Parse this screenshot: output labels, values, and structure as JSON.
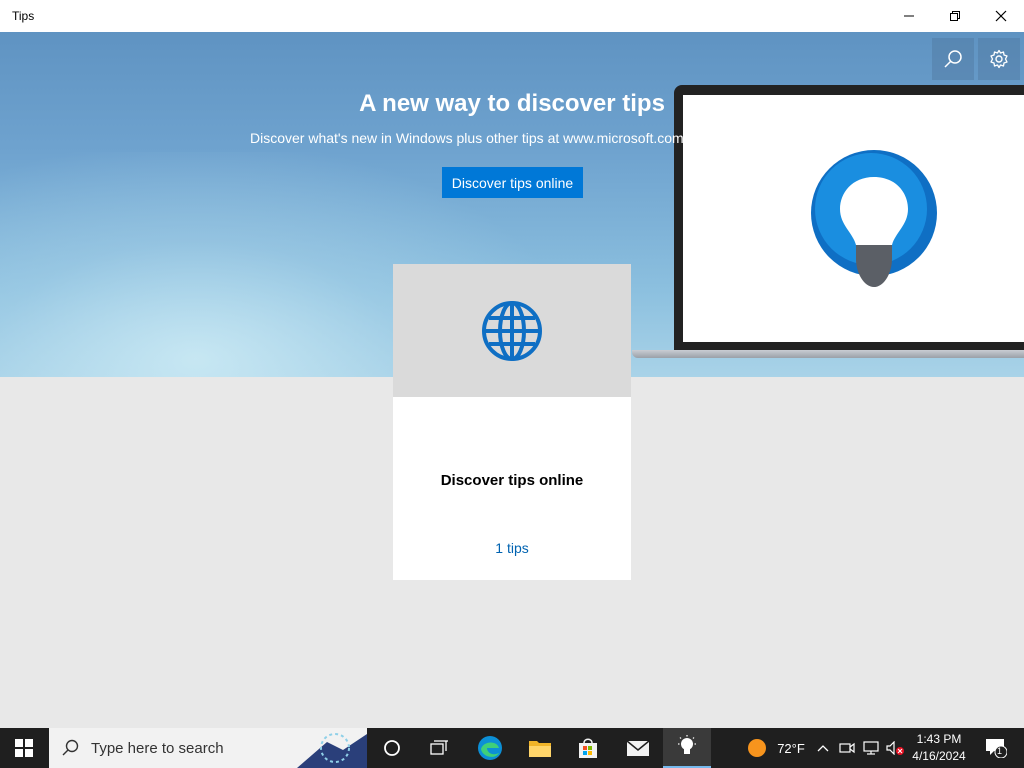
{
  "window": {
    "title": "Tips"
  },
  "hero": {
    "title": "A new way to discover tips",
    "subtitle": "Discover what's new in Windows plus other tips at www.microsoft.com",
    "button_label": "Discover tips online"
  },
  "card": {
    "title": "Discover tips online",
    "count_label": "1 tips"
  },
  "taskbar": {
    "search_placeholder": "Type here to search",
    "weather": "72°F",
    "time": "1:43 PM",
    "date": "4/16/2024",
    "notification_count": "1"
  },
  "colors": {
    "accent": "#0078d7",
    "link": "#0063b1",
    "taskbar": "#1f1f1f"
  }
}
